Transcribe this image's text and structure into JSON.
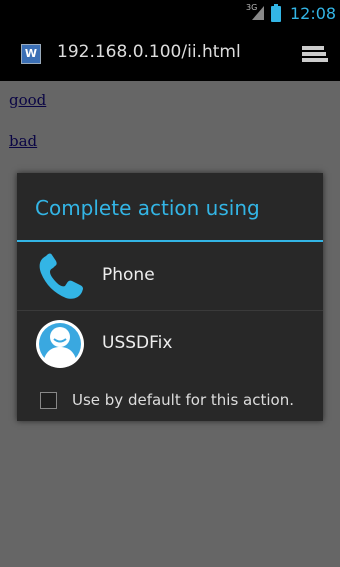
{
  "status_bar": {
    "network_type": "3G",
    "time": "12:08"
  },
  "browser": {
    "url": "192.168.0.100/ii.html",
    "favicon_letter": "W"
  },
  "page": {
    "links": [
      "good",
      "bad"
    ]
  },
  "dialog": {
    "title": "Complete action using",
    "options": [
      {
        "label": "Phone",
        "icon": "phone-icon"
      },
      {
        "label": "USSDFix",
        "icon": "ussdfix-app-icon"
      }
    ],
    "default_checkbox_label": "Use by default for this action.",
    "default_checked": false
  },
  "colors": {
    "accent": "#33b5e5",
    "dialog_bg": "#282828",
    "link": "#1a0dab"
  }
}
